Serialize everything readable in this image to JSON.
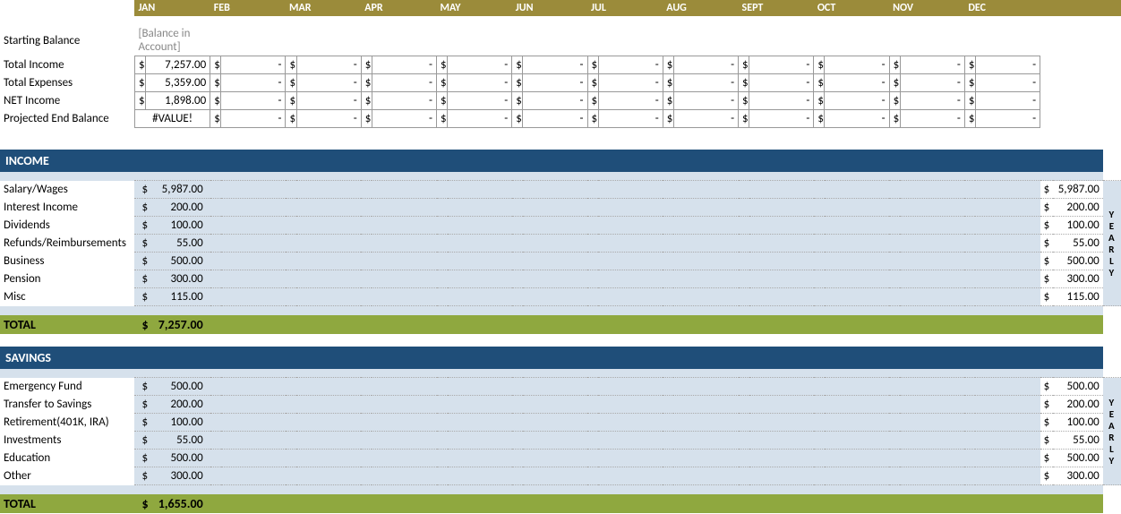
{
  "months": [
    "JAN",
    "FEB",
    "MAR",
    "APR",
    "MAY",
    "JUN",
    "JUL",
    "AUG",
    "SEPT",
    "OCT",
    "NOV",
    "DEC"
  ],
  "summary": {
    "starting_balance": {
      "label": "Starting Balance",
      "jan": "[Balance in Account]"
    },
    "total_income": {
      "label": "Total Income",
      "jan": "7,257.00"
    },
    "total_expenses": {
      "label": "Total Expenses",
      "jan": "5,359.00"
    },
    "net_income": {
      "label": "NET Income",
      "jan": "1,898.00"
    },
    "projected_end": {
      "label": "Projected End Balance",
      "jan": "#VALUE!"
    }
  },
  "income": {
    "header": "INCOME",
    "rows": [
      {
        "label": "Salary/Wages",
        "jan": "5,987.00",
        "yearly": "5,987.00"
      },
      {
        "label": "Interest Income",
        "jan": "200.00",
        "yearly": "200.00"
      },
      {
        "label": "Dividends",
        "jan": "100.00",
        "yearly": "100.00"
      },
      {
        "label": "Refunds/Reimbursements",
        "jan": "55.00",
        "yearly": "55.00"
      },
      {
        "label": "Business",
        "jan": "500.00",
        "yearly": "500.00"
      },
      {
        "label": "Pension",
        "jan": "300.00",
        "yearly": "300.00"
      },
      {
        "label": "Misc",
        "jan": "115.00",
        "yearly": "115.00"
      }
    ],
    "total_label": "TOTAL",
    "total_value": "7,257.00"
  },
  "savings": {
    "header": "SAVINGS",
    "rows": [
      {
        "label": "Emergency Fund",
        "jan": "500.00",
        "yearly": "500.00"
      },
      {
        "label": "Transfer to Savings",
        "jan": "200.00",
        "yearly": "200.00"
      },
      {
        "label": "Retirement(401K, IRA)",
        "jan": "100.00",
        "yearly": "100.00"
      },
      {
        "label": "Investments",
        "jan": "55.00",
        "yearly": "55.00"
      },
      {
        "label": "Education",
        "jan": "500.00",
        "yearly": "500.00"
      },
      {
        "label": "Other",
        "jan": "300.00",
        "yearly": "300.00"
      }
    ],
    "total_label": "TOTAL",
    "total_value": "1,655.00"
  },
  "yearly_label": "YEARLY",
  "dollar": "$",
  "dash": "-"
}
